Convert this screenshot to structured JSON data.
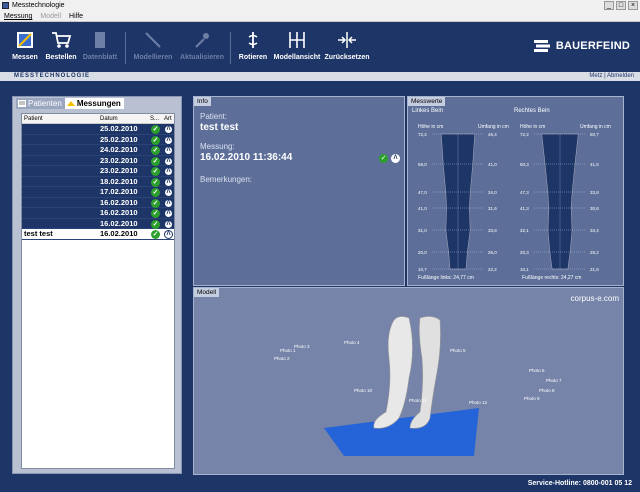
{
  "window": {
    "title": "Messtechnologie"
  },
  "menu": {
    "items": [
      "Messung",
      "Modell",
      "Hilfe"
    ]
  },
  "toolbar": {
    "buttons": [
      {
        "label": "Messen",
        "enabled": true,
        "icon": "measure-icon"
      },
      {
        "label": "Bestellen",
        "enabled": true,
        "icon": "cart-icon"
      },
      {
        "label": "Datenblatt",
        "enabled": false,
        "icon": "datasheet-icon"
      },
      {
        "label": "Modellieren",
        "enabled": false,
        "icon": "model-tool-icon"
      },
      {
        "label": "Aktualisieren",
        "enabled": false,
        "icon": "update-icon"
      },
      {
        "label": "Rotieren",
        "enabled": true,
        "icon": "rotate-icon"
      },
      {
        "label": "Modellansicht",
        "enabled": true,
        "icon": "model-view-icon"
      },
      {
        "label": "Zurücksetzen",
        "enabled": true,
        "icon": "reset-icon"
      }
    ],
    "brand": "BAUERFEIND"
  },
  "strip": {
    "section": "MESSTECHNOLOGIE",
    "user": "Metz",
    "logout": "Abmelden"
  },
  "left": {
    "tabs": [
      "Patienten",
      "Messungen"
    ],
    "columns": [
      "Patient",
      "Datum",
      "S...",
      "Art"
    ],
    "rows": [
      {
        "name": "",
        "date": "25.02.2010"
      },
      {
        "name": "",
        "date": "25.02.2010"
      },
      {
        "name": "",
        "date": "24.02.2010"
      },
      {
        "name": "",
        "date": "23.02.2010"
      },
      {
        "name": "",
        "date": "23.02.2010"
      },
      {
        "name": "",
        "date": "18.02.2010"
      },
      {
        "name": "",
        "date": "17.02.2010"
      },
      {
        "name": "",
        "date": "16.02.2010"
      },
      {
        "name": "",
        "date": "16.02.2010"
      },
      {
        "name": "",
        "date": "16.02.2010"
      },
      {
        "name": "test test",
        "date": "16.02.2010",
        "selected": true
      }
    ]
  },
  "info": {
    "title": "Info",
    "patient_label": "Patient:",
    "patient": "test test",
    "messung_label": "Messung:",
    "messung": "16.02.2010 11:36:44",
    "bemerkungen_label": "Bemerkungen:"
  },
  "messwerte": {
    "title": "Messwerte",
    "left_leg": "Linkes Bein",
    "right_leg": "Rechtes Bein",
    "col_height": "Höhe in cm",
    "col_circ": "Umfang in cm",
    "left_heights": [
      "72,2",
      "59,0",
      "47,0",
      "41,0",
      "31,0",
      "20,0",
      "10,7"
    ],
    "left_circ": [
      "46,4",
      "41,0",
      "34,0",
      "31,6",
      "33,8",
      "26,0",
      "22,2"
    ],
    "right_heights": [
      "72,2",
      "60,3",
      "47,3",
      "41,3",
      "32,1",
      "20,3",
      "10,1"
    ],
    "right_circ": [
      "50,7",
      "41,5",
      "33,8",
      "30,8",
      "33,4",
      "28,2",
      "21,8"
    ],
    "foot_left": "Fußlänge links: 24,77 cm",
    "foot_right": "Fußlänge rechts: 24,27 cm"
  },
  "modell": {
    "title": "Modell",
    "brand": "corpus-e.com",
    "photos": [
      "Photo 1",
      "Photo 2",
      "Photo 3",
      "Photo 4",
      "Photo 5",
      "Photo 6",
      "Photo 7",
      "Photo 8",
      "Photo 9",
      "Photo 10",
      "Photo 11",
      "Photo 12"
    ]
  },
  "footer": {
    "hotline": "Service-Hotline: 0800-001 05 12"
  }
}
